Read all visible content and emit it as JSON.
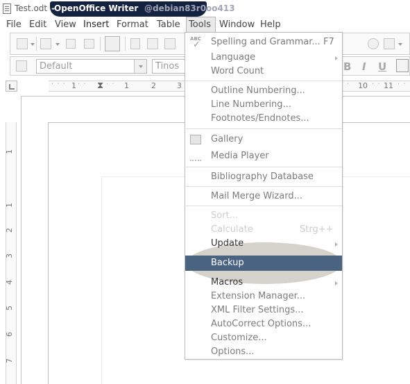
{
  "titlebar": {
    "file": "Test.odt",
    "separator": "-",
    "app": "OpenOffice Writer",
    "host": "@debian83r0oo413"
  },
  "menubar": {
    "items": [
      "File",
      "Edit",
      "View",
      "Insert",
      "Format",
      "Table",
      "Tools",
      "Window",
      "Help"
    ],
    "active": "Tools"
  },
  "toolbar": {
    "paragraph_style": "Default",
    "font_name": "Tinos",
    "bold": "B",
    "italic": "I",
    "underline": "U"
  },
  "ruler": {
    "h_labels": [
      "1",
      "1",
      "2",
      "3",
      "10",
      "11"
    ],
    "v_labels": [
      "1",
      "1",
      "2",
      "3",
      "4",
      "5",
      "6",
      "7"
    ]
  },
  "tools_menu": {
    "items": [
      {
        "label": "Spelling and Grammar...",
        "shortcut": "F7",
        "enabled": true
      },
      {
        "label": "Language",
        "submenu": true,
        "enabled": true
      },
      {
        "label": "Word Count",
        "enabled": true
      },
      {
        "label": "Outline Numbering...",
        "enabled": true
      },
      {
        "label": "Line Numbering...",
        "enabled": true
      },
      {
        "label": "Footnotes/Endnotes...",
        "enabled": true
      },
      {
        "label": "Gallery",
        "enabled": true
      },
      {
        "label": "Media Player",
        "enabled": true
      },
      {
        "label": "Bibliography Database",
        "enabled": true
      },
      {
        "label": "Mail Merge Wizard...",
        "enabled": true
      },
      {
        "label": "Sort...",
        "enabled": false
      },
      {
        "label": "Calculate",
        "shortcut": "Strg++",
        "enabled": false
      },
      {
        "label": "Update",
        "submenu": true,
        "enabled": true
      },
      {
        "label": "Backup",
        "enabled": true,
        "highlighted": true
      },
      {
        "label": "Macros",
        "submenu": true,
        "enabled": true
      },
      {
        "label": "Extension Manager...",
        "enabled": true
      },
      {
        "label": "XML Filter Settings...",
        "enabled": true
      },
      {
        "label": "AutoCorrect Options...",
        "enabled": true
      },
      {
        "label": "Customize...",
        "enabled": true
      },
      {
        "label": "Options...",
        "enabled": true
      }
    ],
    "spelling_icon_text": "ABC"
  },
  "colors": {
    "highlight": "#4a6381",
    "title_pill": "#15223f",
    "annotation_ellipse": "#d4d2cb"
  }
}
